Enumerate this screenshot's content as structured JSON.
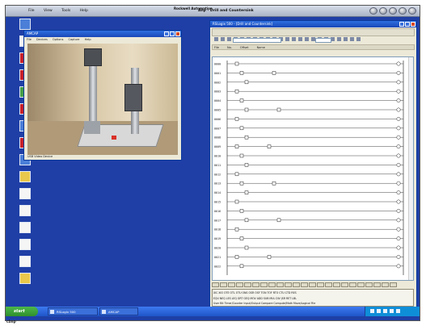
{
  "menubar": {
    "items": [
      "File",
      "View",
      "Tools",
      "Help"
    ],
    "brand": "Rockwell Automation",
    "title": "Ahp - Drill and Countersink"
  },
  "desktop_icons": [
    {
      "label": "",
      "color": "blue"
    },
    {
      "label": "",
      "color": "white"
    },
    {
      "label": "",
      "color": "red"
    },
    {
      "label": "",
      "color": "red"
    },
    {
      "label": "",
      "color": "green"
    },
    {
      "label": "",
      "color": "red"
    },
    {
      "label": "",
      "color": "blue"
    },
    {
      "label": "",
      "color": "red"
    },
    {
      "label": "",
      "color": "blue"
    },
    {
      "label": "",
      "color": "yellow"
    },
    {
      "label": "",
      "color": "white"
    },
    {
      "label": "",
      "color": "white"
    },
    {
      "label": "",
      "color": "white"
    },
    {
      "label": "",
      "color": "white"
    },
    {
      "label": "",
      "color": "white"
    },
    {
      "label": "",
      "color": "yellow"
    }
  ],
  "video_window": {
    "title": "AMCAP",
    "menu": [
      "File",
      "Devices",
      "Options",
      "Capture",
      "Help"
    ],
    "status": "USB Video Device"
  },
  "plc_window": {
    "title": "RSLogix 500 - [Drill and Countersink]",
    "file_label": "",
    "col_headers": [
      "File",
      "No.",
      "Offset",
      "Name"
    ],
    "rung_numbers": [
      "0000",
      "0001",
      "0002",
      "0003",
      "0004",
      "0005",
      "0006",
      "0007",
      "0008",
      "0009",
      "0010",
      "0011",
      "0012",
      "0013",
      "0014",
      "0015",
      "0016",
      "0017",
      "0018",
      "0019",
      "0020",
      "0021",
      "0022"
    ],
    "instruction_rows": [
      "XIC  XIO  OTE  OTL  OTU  ONS  OSR  OSF  TON  TOF  RTO  CTU  CTD  RES",
      "EQU  NEQ  LES  LEQ  GRT  GEQ  MOV  ADD  SUB  MUL  DIV  JSR  RET  LBL",
      "User  Bit  Timer/Counter  Input/Output  Compare  Compute/Math  Move/Logical  File"
    ]
  },
  "taskbar": {
    "start_label": "start",
    "tasks": [
      "RSLogix 500",
      "AMCAP"
    ]
  },
  "bottom_text": "cbsp"
}
